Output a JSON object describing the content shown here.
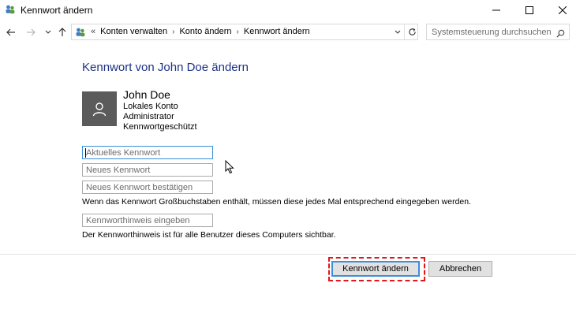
{
  "window": {
    "title": "Kennwort ändern",
    "controls": [
      "minimize",
      "maximize",
      "close"
    ]
  },
  "nav": {
    "breadcrumb_prefix": "«",
    "breadcrumbs": [
      "Konten verwalten",
      "Konto ändern",
      "Kennwort ändern"
    ],
    "search_placeholder": "Systemsteuerung durchsuchen"
  },
  "main": {
    "heading": "Kennwort von John Doe ändern",
    "user": {
      "name": "John Doe",
      "lines": [
        "Lokales Konto",
        "Administrator",
        "Kennwortgeschützt"
      ]
    },
    "fields": {
      "current": "Aktuelles Kennwort",
      "new": "Neues Kennwort",
      "confirm": "Neues Kennwort bestätigen",
      "hint": "Kennworthinweis eingeben"
    },
    "case_note": "Wenn das Kennwort Großbuchstaben enthält, müssen diese jedes Mal entsprechend eingegeben werden.",
    "hint_note": "Der Kennworthinweis ist für alle Benutzer dieses Computers sichtbar."
  },
  "footer": {
    "change_label": "Kennwort ändern",
    "cancel_label": "Abbrechen"
  },
  "colors": {
    "heading": "#1e3287",
    "focus_border": "#3c8fd8",
    "highlight": "#e2161b",
    "avatar_bg": "#5b5b5b"
  }
}
